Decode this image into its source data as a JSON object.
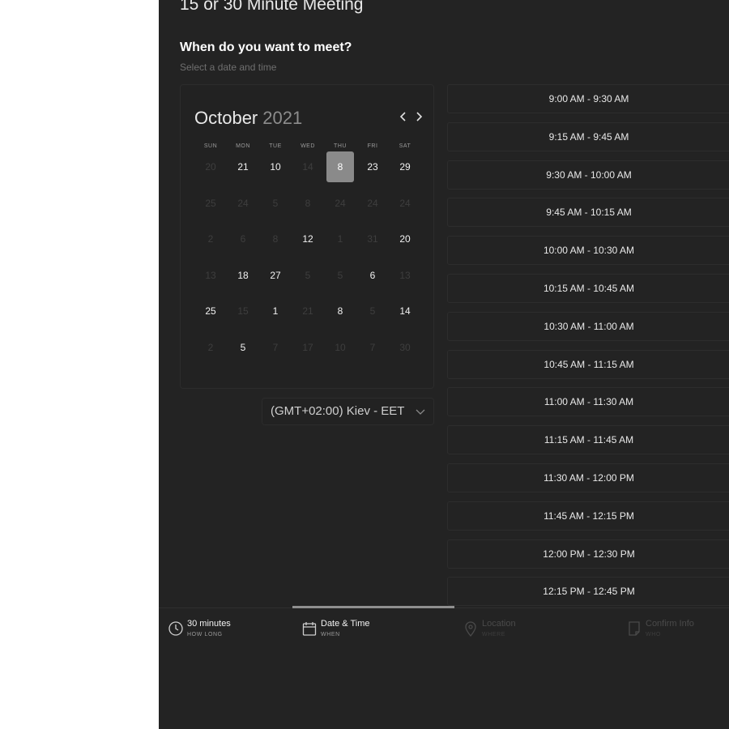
{
  "title": "15 or 30 Minute Meeting",
  "heading": "When do you want to meet?",
  "subheading": "Select a date and time",
  "calendar": {
    "month": "October",
    "year": "2021",
    "prev_icon": "chevron-left-icon",
    "next_icon": "chevron-right-icon",
    "weekdays": [
      "SUN",
      "MON",
      "TUE",
      "WED",
      "THU",
      "FRI",
      "SAT"
    ],
    "weeks": [
      [
        {
          "d": "20",
          "a": false
        },
        {
          "d": "21",
          "a": true
        },
        {
          "d": "10",
          "a": true
        },
        {
          "d": "14",
          "a": false
        },
        {
          "d": "8",
          "a": true,
          "s": true
        },
        {
          "d": "23",
          "a": true
        },
        {
          "d": "29",
          "a": true
        }
      ],
      [
        {
          "d": "25",
          "a": false
        },
        {
          "d": "24",
          "a": false
        },
        {
          "d": "5",
          "a": false
        },
        {
          "d": "8",
          "a": false
        },
        {
          "d": "24",
          "a": false
        },
        {
          "d": "24",
          "a": false
        },
        {
          "d": "24",
          "a": false
        }
      ],
      [
        {
          "d": "2",
          "a": false
        },
        {
          "d": "6",
          "a": false
        },
        {
          "d": "8",
          "a": false
        },
        {
          "d": "12",
          "a": true
        },
        {
          "d": "1",
          "a": false
        },
        {
          "d": "31",
          "a": false
        },
        {
          "d": "20",
          "a": true
        }
      ],
      [
        {
          "d": "13",
          "a": false
        },
        {
          "d": "18",
          "a": true
        },
        {
          "d": "27",
          "a": true
        },
        {
          "d": "5",
          "a": false
        },
        {
          "d": "5",
          "a": false
        },
        {
          "d": "6",
          "a": true
        },
        {
          "d": "13",
          "a": false
        }
      ],
      [
        {
          "d": "25",
          "a": true
        },
        {
          "d": "15",
          "a": false
        },
        {
          "d": "1",
          "a": true
        },
        {
          "d": "21",
          "a": false
        },
        {
          "d": "8",
          "a": true
        },
        {
          "d": "5",
          "a": false
        },
        {
          "d": "14",
          "a": true
        }
      ],
      [
        {
          "d": "2",
          "a": false
        },
        {
          "d": "5",
          "a": true
        },
        {
          "d": "7",
          "a": false
        },
        {
          "d": "17",
          "a": false
        },
        {
          "d": "10",
          "a": false
        },
        {
          "d": "7",
          "a": false
        },
        {
          "d": "30",
          "a": false
        }
      ]
    ]
  },
  "timezone": {
    "value": "(GMT+02:00) Kiev - EET",
    "icon": "chevron-down-icon"
  },
  "slots": [
    "9:00 AM - 9:30 AM",
    "9:15 AM - 9:45 AM",
    "9:30 AM - 10:00 AM",
    "9:45 AM - 10:15 AM",
    "10:00 AM - 10:30 AM",
    "10:15 AM - 10:45 AM",
    "10:30 AM - 11:00 AM",
    "10:45 AM - 11:15 AM",
    "11:00 AM - 11:30 AM",
    "11:15 AM - 11:45 AM",
    "11:30 AM - 12:00 PM",
    "11:45 AM - 12:15 PM",
    "12:00 PM - 12:30 PM",
    "12:15 PM - 12:45 PM"
  ],
  "tabs": [
    {
      "label": "30 minutes",
      "sub": "HOW LONG",
      "icon": "clock-icon"
    },
    {
      "label": "Date & Time",
      "sub": "WHEN",
      "icon": "calendar-icon"
    },
    {
      "label": "Location",
      "sub": "WHERE",
      "icon": "location-pin-icon"
    },
    {
      "label": "Confirm Info",
      "sub": "WHO",
      "icon": "document-icon"
    }
  ],
  "colors": {
    "panel_bg": "#232323",
    "selected_day": "#8a8a8a",
    "text": "#e9e9e9"
  }
}
